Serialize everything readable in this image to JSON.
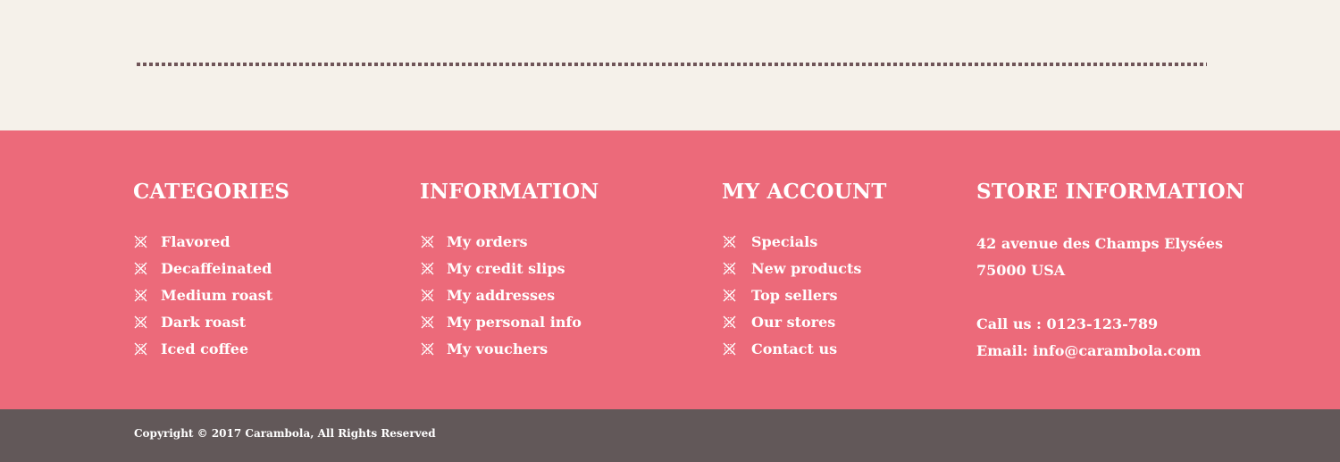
{
  "footer": {
    "categories": {
      "title": "CATEGORIES",
      "items": [
        "Flavored",
        "Decaffeinated",
        "Medium roast",
        "Dark roast",
        "Iced coffee"
      ]
    },
    "information": {
      "title": "INFORMATION",
      "items": [
        "My orders",
        "My credit slips",
        "My addresses",
        "My personal info",
        "My vouchers"
      ]
    },
    "account": {
      "title": "MY ACCOUNT",
      "items": [
        "Specials",
        "New products",
        "Top sellers",
        "Our stores",
        "Contact us"
      ]
    },
    "store": {
      "title": "STORE INFORMATION",
      "address_line1": "42 avenue des Champs Elysées",
      "address_line2": "75000  USA",
      "phone": "Call us : 0123-123-789",
      "email": "Email: info@carambola.com"
    },
    "copyright": "Copyright © 2017 Carambola, All Rights Reserved"
  },
  "colors": {
    "background_cream": "#f5f1ea",
    "footer_pink": "#ec6a7a",
    "footer_bottom": "#625859",
    "divider_dots": "#6f5558"
  },
  "icons": {
    "list_bullet": "crossed-circle-icon"
  }
}
